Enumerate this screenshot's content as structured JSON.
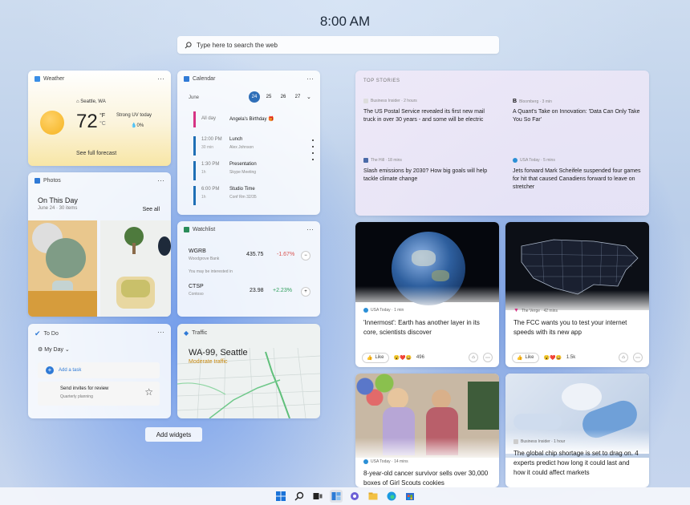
{
  "clock": "8:00 AM",
  "search": {
    "placeholder": "Type here to search the web"
  },
  "weather": {
    "title": "Weather",
    "location": "Seattle, WA",
    "temp": "72",
    "unit_f": "°F",
    "unit_c": "°C",
    "condition": "Strong UV today",
    "precip": "0%",
    "link": "See full forecast"
  },
  "photos": {
    "title": "Photos",
    "heading": "On This Day",
    "sub": "June 24 · 30 items",
    "link": "See all"
  },
  "todo": {
    "title": "To Do",
    "list": "My Day",
    "add": "Add a task",
    "task_title": "Send invites for review",
    "task_sub": "Quarterly planning"
  },
  "calendar": {
    "title": "Calendar",
    "month": "June",
    "days": [
      "24",
      "25",
      "26",
      "27"
    ],
    "events": [
      {
        "time": "All day",
        "dur": "",
        "title": "Angela's Birthday",
        "sub": "",
        "color": "#d63384"
      },
      {
        "time": "12:00 PM",
        "dur": "30 min",
        "title": "Lunch",
        "sub": "Alex Johnson",
        "color": "#1f6fb5"
      },
      {
        "time": "1:30 PM",
        "dur": "1h",
        "title": "Presentation",
        "sub": "Skype Meeting",
        "color": "#1f6fb5"
      },
      {
        "time": "6:00 PM",
        "dur": "1h",
        "title": "Studio Time",
        "sub": "Conf Rm 32/35",
        "color": "#1f6fb5"
      }
    ]
  },
  "watchlist": {
    "title": "Watchlist",
    "interest": "You may be interested in",
    "stocks": [
      {
        "sym": "WGRB",
        "name": "Woodgrove Bank",
        "price": "435.75",
        "change": "-1.67%",
        "color": "#d9534f"
      },
      {
        "sym": "CTSP",
        "name": "Contoso",
        "price": "23.98",
        "change": "+2.23%",
        "color": "#2e9e5b"
      }
    ]
  },
  "traffic": {
    "title": "Traffic",
    "road": "WA-99, Seattle",
    "status": "Moderate traffic"
  },
  "top_stories": {
    "label": "TOP STORIES",
    "items": [
      {
        "source": "Business Insider · 2 hours",
        "headline": "The US Postal Service revealed its first new mail truck in over 30 years - and some will be electric"
      },
      {
        "source": "Bloomberg · 3 min",
        "headline": "A Quant's Take on Innovation: 'Data Can Only Take You So Far'"
      },
      {
        "source": "The Hill · 18 mins",
        "headline": "Slash emissions by 2030? How big goals will help tackle climate change"
      },
      {
        "source": "USA Today · 5 mins",
        "headline": "Jets forward Mark Scheifele suspended four games for hit that caused Canadiens forward to leave on stretcher"
      }
    ]
  },
  "news_cards": [
    {
      "source": "USA Today · 1 min",
      "headline": "'Innermost': Earth has another layer in its core, scientists discover",
      "like": "Like",
      "count": "496"
    },
    {
      "source": "The Verge · 42 mins",
      "headline": "The FCC wants you to test your internet speeds with its new app",
      "like": "Like",
      "count": "1.5k"
    },
    {
      "source": "USA Today · 14 mins",
      "headline": "8-year-old cancer survivor sells over 30,000 boxes of Girl Scouts cookies"
    },
    {
      "source": "Business Insider · 1 hour",
      "headline": "The global chip shortage is set to drag on. 4 experts predict how long it could last and how it could affect markets"
    }
  ],
  "add_widgets": "Add widgets",
  "more": "···"
}
